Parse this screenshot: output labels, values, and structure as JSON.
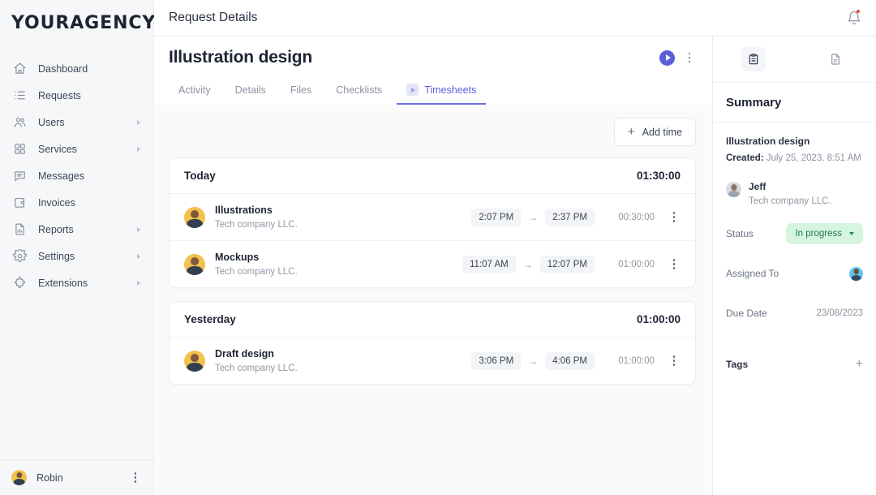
{
  "sidebar": {
    "logo": "YOURAGENCY",
    "items": [
      {
        "label": "Dashboard",
        "icon": "home-icon",
        "caret": false
      },
      {
        "label": "Requests",
        "icon": "list-icon",
        "caret": false
      },
      {
        "label": "Users",
        "icon": "users-icon",
        "caret": true
      },
      {
        "label": "Services",
        "icon": "grid-icon",
        "caret": true
      },
      {
        "label": "Messages",
        "icon": "chat-icon",
        "caret": false
      },
      {
        "label": "Invoices",
        "icon": "wallet-icon",
        "caret": false
      },
      {
        "label": "Reports",
        "icon": "chart-doc-icon",
        "caret": true
      },
      {
        "label": "Settings",
        "icon": "gear-icon",
        "caret": true
      },
      {
        "label": "Extensions",
        "icon": "puzzle-icon",
        "caret": true
      }
    ],
    "footer": {
      "user": "Robin"
    }
  },
  "topbar": {
    "title": "Request Details",
    "bell": "notification-bell-icon"
  },
  "main": {
    "title": "Illustration design",
    "tabs": [
      {
        "label": "Activity",
        "active": false
      },
      {
        "label": "Details",
        "active": false
      },
      {
        "label": "Files",
        "active": false
      },
      {
        "label": "Checklists",
        "active": false
      },
      {
        "label": "Timesheets",
        "active": true
      }
    ],
    "add_time_label": "Add time",
    "groups": [
      {
        "day": "Today",
        "total": "01:30:00",
        "entries": [
          {
            "title": "Illustrations",
            "company": "Tech company LLC.",
            "start": "2:07 PM",
            "end": "2:37 PM",
            "duration": "00:30:00"
          },
          {
            "title": "Mockups",
            "company": "Tech company LLC.",
            "start": "11:07 AM",
            "end": "12:07 PM",
            "duration": "01:00:00"
          }
        ]
      },
      {
        "day": "Yesterday",
        "total": "01:00:00",
        "entries": [
          {
            "title": "Draft design",
            "company": "Tech company LLC.",
            "start": "3:06 PM",
            "end": "4:06 PM",
            "duration": "01:00:00"
          }
        ]
      }
    ]
  },
  "right": {
    "tabs": [
      {
        "icon": "clipboard-icon",
        "active": true
      },
      {
        "icon": "document-icon",
        "active": false
      }
    ],
    "title": "Summary",
    "request_name": "Illustration design",
    "created_label": "Created:",
    "created_value": "July 25, 2023, 8:51 AM",
    "user": {
      "name": "Jeff",
      "company": "Tech company LLC."
    },
    "fields": {
      "status_label": "Status",
      "status_value": "In progress",
      "assigned_label": "Assigned To",
      "due_label": "Due Date",
      "due_value": "23/08/2023"
    },
    "tags_label": "Tags"
  },
  "colors": {
    "accent": "#5b5fd6",
    "status_bg": "#d6f5e0",
    "status_text": "#1f7a47",
    "notification_dot": "#e8453c"
  }
}
